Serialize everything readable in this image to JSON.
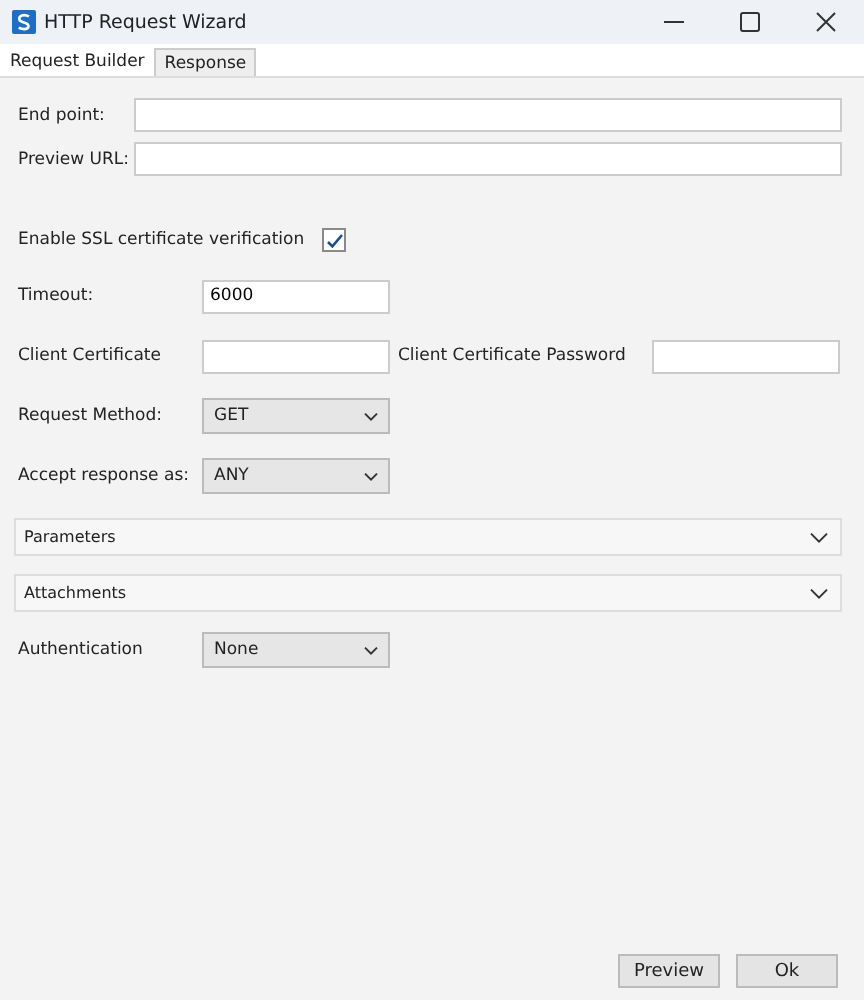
{
  "window": {
    "title": "HTTP Request Wizard"
  },
  "tabs": [
    {
      "label": "Request Builder",
      "selected": true
    },
    {
      "label": "Response",
      "selected": false
    }
  ],
  "end_point": {
    "label": "End point:"
  },
  "preview_url": {
    "label": "Preview URL:"
  },
  "ssl": {
    "label": "Enable SSL certificate verification",
    "checked": true
  },
  "timeout": {
    "label": "Timeout:",
    "value": "6000"
  },
  "client_certificate": {
    "label": "Client Certificate"
  },
  "client_certificate_password": {
    "label": "Client Certificate Password"
  },
  "request_method": {
    "label": "Request Method:",
    "value": "GET"
  },
  "accept_response": {
    "label": "Accept response as:",
    "value": "ANY"
  },
  "sections": [
    {
      "label": "Parameters",
      "expanded": false
    },
    {
      "label": "Attachments",
      "expanded": false
    }
  ],
  "authentication": {
    "label": "Authentication",
    "value": "None"
  },
  "buttons": [
    "Preview",
    "Ok"
  ]
}
